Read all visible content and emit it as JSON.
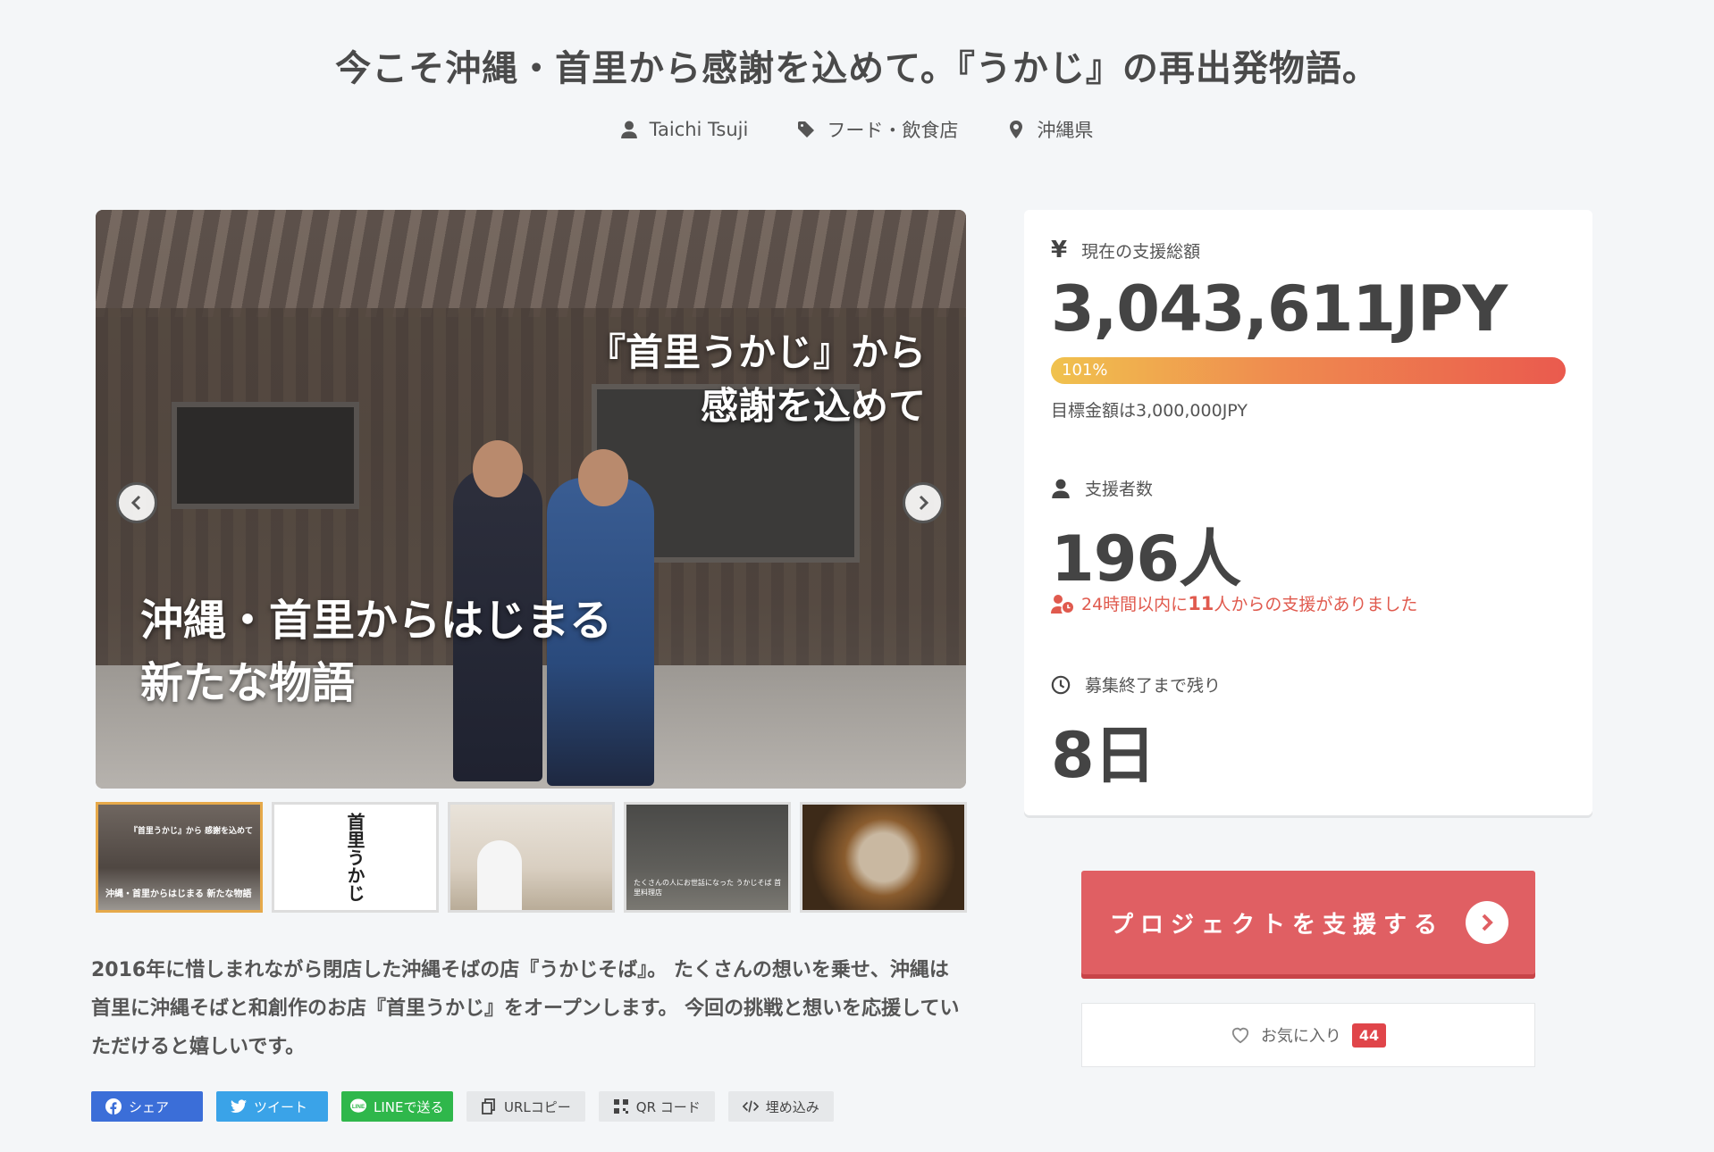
{
  "header": {
    "title": "今こそ沖縄・首里から感謝を込めて。『うかじ』の再出発物語。",
    "author": "Taichi Tsuji",
    "category": "フード・飲食店",
    "location": "沖縄県"
  },
  "hero": {
    "overlay_top_line1": "『首里うかじ』から",
    "overlay_top_line2": "感謝を込めて",
    "overlay_bottom_line1": "沖縄・首里からはじまる",
    "overlay_bottom_line2": "新たな物語"
  },
  "thumbnails": [
    {
      "text_top": "『首里うかじ』から 感謝を込めて",
      "text_bottom": "沖縄・首里からはじまる 新たな物語"
    },
    {
      "text": "首里うかじ"
    },
    {},
    {
      "caption": "たくさんの人にお世話になった うかじそば 首里料理店"
    },
    {}
  ],
  "description": "2016年に惜しまれながら閉店した沖縄そばの店『うかじそば』。 たくさんの想いを乗せ、沖縄は首里に沖縄そばと和創作のお店『首里うかじ』をオープンします。 今回の挑戦と想いを応援していただけると嬉しいです。",
  "share": {
    "facebook": "シェア",
    "twitter": "ツイート",
    "line": "LINEで送る",
    "url_copy": "URLコピー",
    "qr": "QR コード",
    "embed": "埋め込み"
  },
  "stats": {
    "currency_symbol": "¥",
    "total_label": "現在の支援総額",
    "total_value": "3,043,611JPY",
    "progress_percent": 101,
    "progress_label": "101%",
    "goal_text": "目標金額は3,000,000JPY",
    "backers_label": "支援者数",
    "backers_value": "196人",
    "recent_prefix": "24時間以内に",
    "recent_count": "11",
    "recent_suffix": "人からの支援がありました",
    "remaining_label": "募集終了まで残り",
    "remaining_value": "8日"
  },
  "actions": {
    "support_label": "プロジェクトを支援する",
    "favorite_label": "お気に入り",
    "favorite_count": "44"
  },
  "colors": {
    "accent": "#e05f63",
    "progress_start": "#f0c24e",
    "progress_end": "#ea5a4e",
    "facebook": "#3b6ed8",
    "twitter": "#3aa3e8",
    "line": "#2fb74b"
  }
}
